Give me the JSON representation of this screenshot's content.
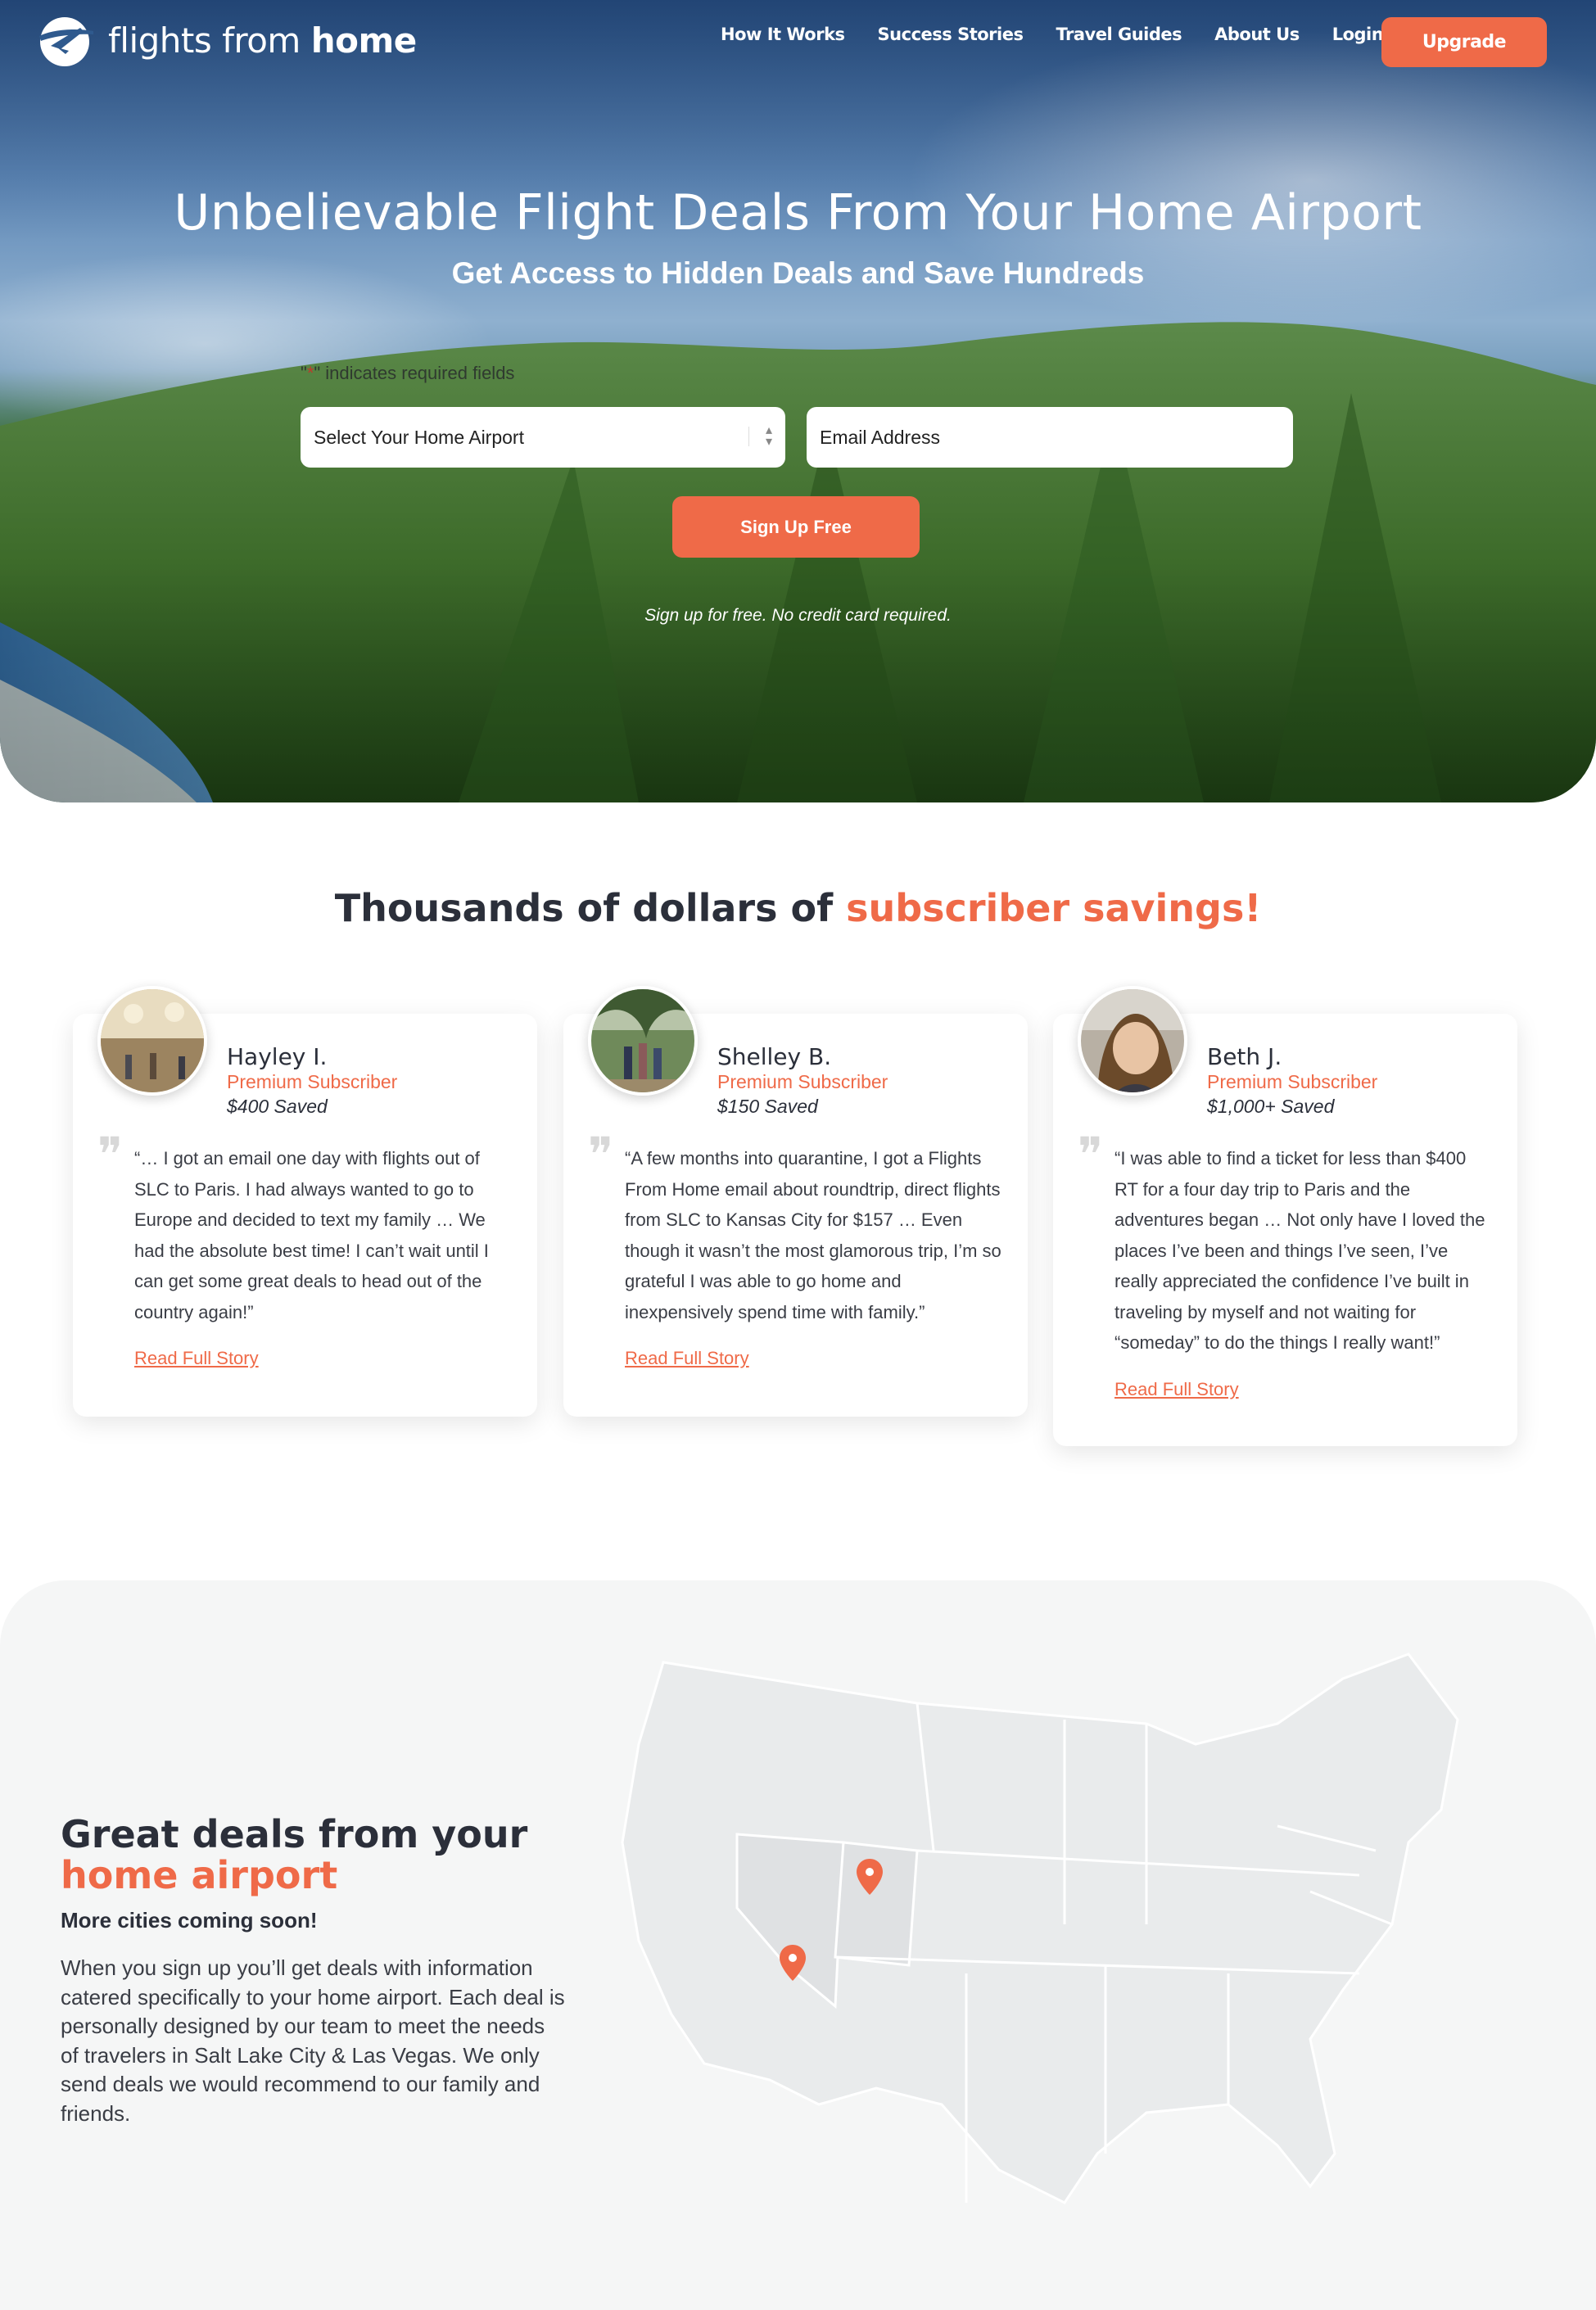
{
  "brand": {
    "logo_text_light": "flights from ",
    "logo_text_bold": "home",
    "accent_color": "#ef6a48"
  },
  "nav": {
    "links": [
      "How It Works",
      "Success Stories",
      "Travel Guides",
      "About Us",
      "Login"
    ],
    "upgrade_label": "Upgrade"
  },
  "hero": {
    "title": "Unbelievable Flight Deals From Your Home Airport",
    "subtitle": "Get Access to Hidden Deals and Save Hundreds",
    "required_prefix": "\"",
    "required_star": "*",
    "required_suffix": "\" indicates required fields",
    "airport_placeholder": "Select Your Home Airport",
    "email_placeholder": "Email Address",
    "signup_label": "Sign Up Free",
    "note": "Sign up for free. No credit card required."
  },
  "savings": {
    "title_plain": "Thousands of dollars of ",
    "title_accent": "subscriber savings!",
    "cards": [
      {
        "name": "Hayley I.",
        "role": "Premium Subscriber",
        "saved": "$400 Saved",
        "quote": "“… I got an email one day with flights out of SLC to Paris. I had always wanted to go to Europe and decided to text my family … We had the absolute best time! I can’t wait until I can get some great deals to head out of the country again!”",
        "link": "Read Full Story",
        "avatar_icon": "photo-palace-hall"
      },
      {
        "name": "Shelley B.",
        "role": "Premium Subscriber",
        "saved": "$150 Saved",
        "quote": "“A few months into quarantine, I got a Flights From Home email about roundtrip, direct flights from SLC to Kansas City for $157 … Even though it wasn’t the most glamorous trip, I’m so grateful I was able to go home and inexpensively spend time with family.”",
        "link": "Read Full Story",
        "avatar_icon": "photo-family-trees"
      },
      {
        "name": "Beth J.",
        "role": "Premium Subscriber",
        "saved": "$1,000+ Saved",
        "quote": "“I was able to find a ticket for less than $400 RT for a four day trip to Paris and the adventures began … Not only have I loved the places I’ve been and things I’ve seen, I’ve really appreciated the confidence I’ve built in traveling by myself and not waiting for “someday” to do the things I really want!”",
        "link": "Read Full Story",
        "avatar_icon": "photo-portrait-smile"
      }
    ]
  },
  "deals": {
    "heading_line1": "Great deals from your",
    "heading_line2": "home airport",
    "coming_soon": "More cities coming soon!",
    "body": "When you sign up you’ll get deals with information catered specifically to your home airport. Each deal is personally designed by our team to meet the needs of travelers in Salt Lake City & Las Vegas. We only send deals we would recommend to our family and friends.",
    "map_pins": [
      "map-pin-icon",
      "map-pin-icon"
    ]
  }
}
